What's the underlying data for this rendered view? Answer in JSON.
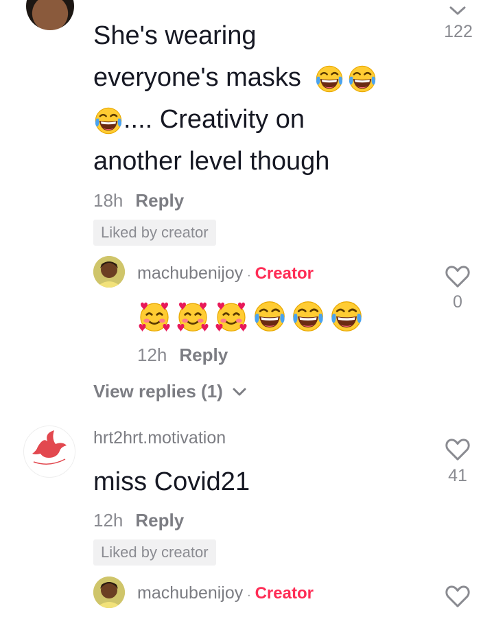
{
  "comment1": {
    "text_line1": "She's wearing",
    "text_line2": "everyone's masks",
    "text_line3": ".... Creativity on",
    "text_line4": "another level though",
    "time": "18h",
    "reply_label": "Reply",
    "badge": "Liked by creator",
    "like_count": "122"
  },
  "reply1": {
    "username": "machubenijoy",
    "separator": "·",
    "creator_label": "Creator",
    "time": "12h",
    "reply_label": "Reply",
    "like_count": "0",
    "emojis": [
      "heart-face",
      "heart-face",
      "heart-face",
      "laughing-tears",
      "laughing-tears",
      "laughing-tears"
    ]
  },
  "view_replies": {
    "label": "View replies (1)"
  },
  "comment2": {
    "username": "hrt2hrt.motivation",
    "text": "miss Covid21",
    "time": "12h",
    "reply_label": "Reply",
    "badge": "Liked by creator",
    "like_count": "41"
  },
  "reply2": {
    "username": "machubenijoy",
    "separator": "·",
    "creator_label": "Creator"
  },
  "colors": {
    "accent": "#fe2c55",
    "text": "#161823",
    "muted": "#8a8b91",
    "dove": "#e2484f"
  }
}
